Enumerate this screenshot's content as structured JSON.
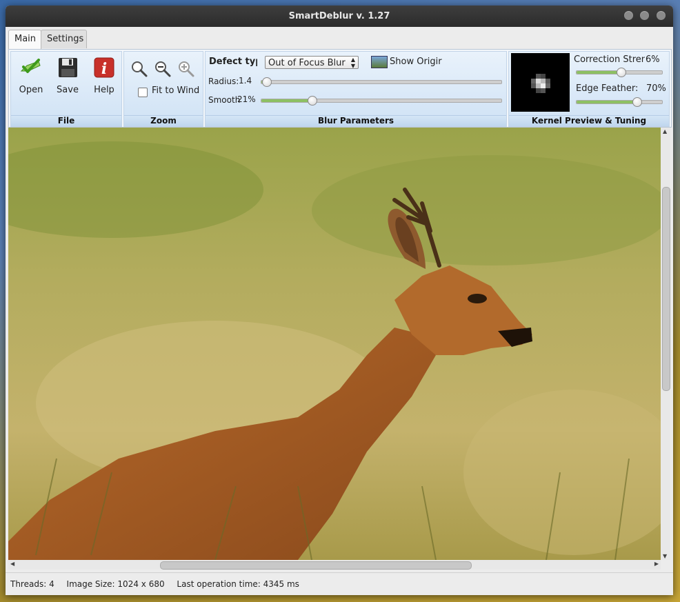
{
  "window": {
    "title": "SmartDeblur v. 1.27"
  },
  "tabs": [
    {
      "label": "Main",
      "active": true
    },
    {
      "label": "Settings",
      "active": false
    }
  ],
  "file_group": {
    "label": "File",
    "open_label": "Open",
    "save_label": "Save",
    "help_label": "Help"
  },
  "zoom_group": {
    "label": "Zoom",
    "fit_label": "Fit to Wind",
    "fit_checked": false,
    "icons": [
      "zoom-reset-icon",
      "zoom-out-icon",
      "zoom-in-icon"
    ]
  },
  "blur_group": {
    "label": "Blur Parameters",
    "defect_type_label": "Defect typ",
    "defect_type_value": "Out of Focus Blur",
    "show_original_label": "Show Origir",
    "radius_label": "Radius:",
    "radius_value": "1.4",
    "radius_level": 0.02,
    "smooth_label": "Smooth",
    "smooth_value": "21%",
    "smooth_level": 0.21
  },
  "kernel_group": {
    "label": "Kernel Preview & Tuning",
    "correction_label": "Correction Stren",
    "correction_value": "6%",
    "correction_level": 0.52,
    "edge_label": "Edge Feather:",
    "edge_value": "70%",
    "edge_level": 0.7
  },
  "status": {
    "threads": "Threads: 4",
    "image_size": "Image Size: 1024 x 680",
    "last_op": "Last operation time: 4345 ms"
  },
  "colors": {
    "ribbon_bg": "#d8e8f7",
    "slider_fill": "#8dc063",
    "help_red": "#c8302a",
    "check_green": "#5fae2e"
  }
}
